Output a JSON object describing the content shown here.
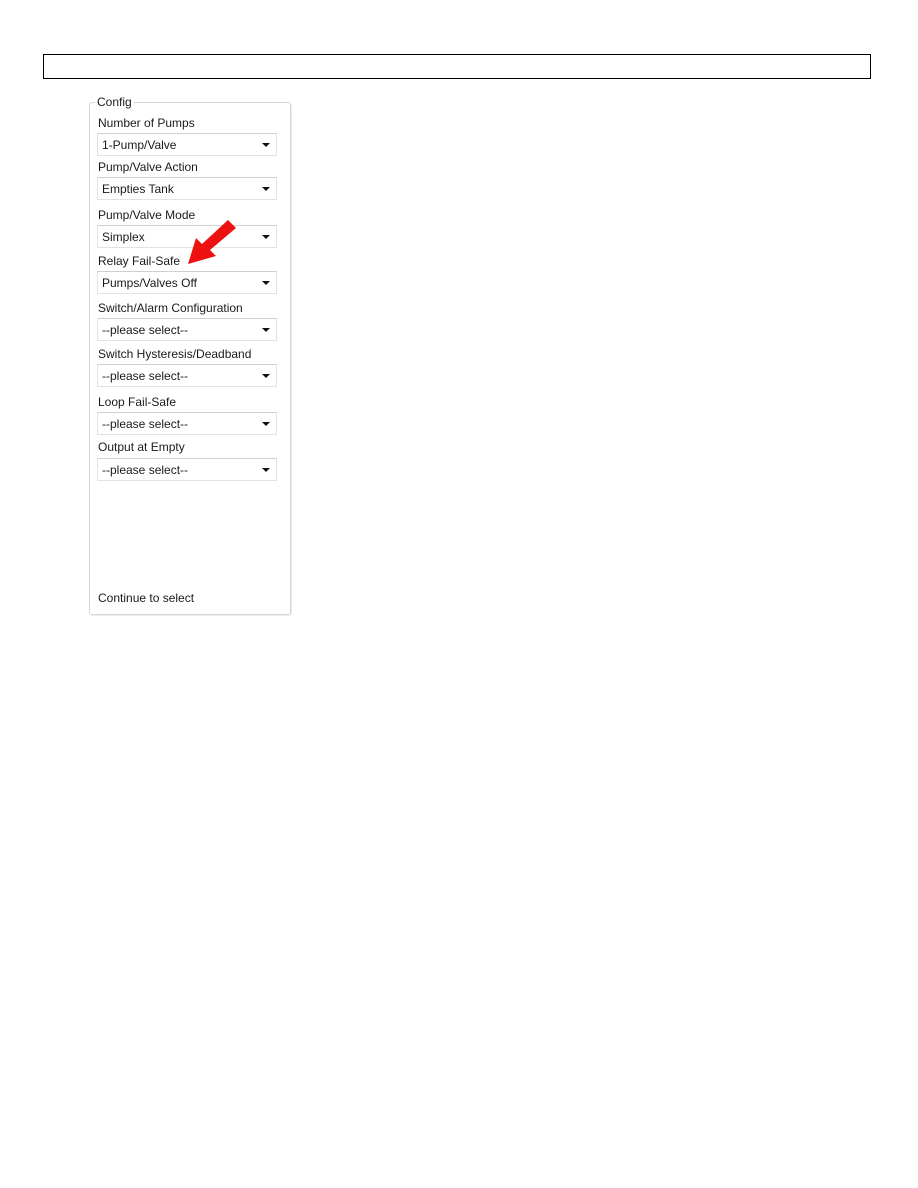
{
  "header": {
    "text": ""
  },
  "config": {
    "legend": "Config",
    "fields": [
      {
        "label": "Number of Pumps",
        "value": "1-Pump/Valve"
      },
      {
        "label": "Pump/Valve Action",
        "value": "Empties Tank"
      },
      {
        "label": "Pump/Valve Mode",
        "value": "Simplex"
      },
      {
        "label": "Relay Fail-Safe",
        "value": "Pumps/Valves Off"
      },
      {
        "label": "Switch/Alarm Configuration",
        "value": "--please select--"
      },
      {
        "label": "Switch Hysteresis/Deadband",
        "value": "--please select--"
      },
      {
        "label": "Loop Fail-Safe",
        "value": "--please select--"
      },
      {
        "label": "Output at Empty",
        "value": "--please select--"
      }
    ],
    "footer": "Continue to select"
  },
  "annotation": {
    "icon": "red-arrow-icon",
    "color": "#ee1111",
    "points_to": "Relay Fail-Safe"
  }
}
